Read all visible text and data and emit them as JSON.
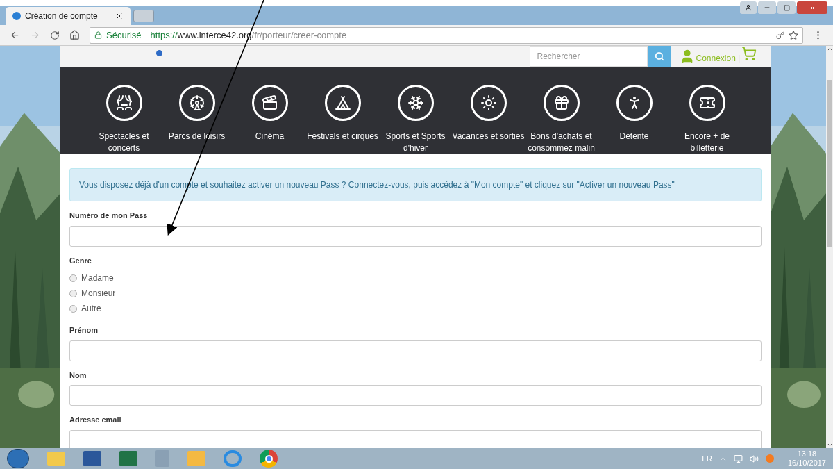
{
  "browser": {
    "tabs": [
      {
        "title": "Création de compte",
        "selected": true
      }
    ],
    "secure_label": "Sécurisé",
    "url_scheme": "https://",
    "url_host": "www.interce42.org",
    "url_path": "/fr/porteur/creer-compte"
  },
  "header": {
    "search": {
      "placeholder": "Rechercher"
    },
    "login": "Connexion",
    "separator": "|"
  },
  "nav": [
    {
      "label": "Spectacles et concerts"
    },
    {
      "label": "Parcs de loisirs"
    },
    {
      "label": "Cinéma"
    },
    {
      "label": "Festivals et cirques"
    },
    {
      "label": "Sports et Sports d'hiver"
    },
    {
      "label": "Vacances et sorties"
    },
    {
      "label": "Bons d'achats et consommez malin"
    },
    {
      "label": "Détente"
    },
    {
      "label": "Encore + de billetterie"
    }
  ],
  "alert": "Vous disposez déjà d'un compte et souhaitez activer un nouveau Pass ? Connectez-vous, puis accédez à \"Mon compte\" et cliquez sur \"Activer un nouveau Pass\"",
  "form": [
    {
      "kind": "text",
      "label": "Numéro de mon Pass"
    },
    {
      "kind": "radio",
      "label": "Genre",
      "options": [
        {
          "label": "Madame",
          "selected": false
        },
        {
          "label": "Monsieur",
          "selected": false
        },
        {
          "label": "Autre",
          "selected": false
        }
      ]
    },
    {
      "kind": "text",
      "label": "Prénom"
    },
    {
      "kind": "text",
      "label": "Nom"
    },
    {
      "kind": "text",
      "label": "Adresse email"
    }
  ],
  "taskbar": {
    "language": "FR",
    "time": "13:18",
    "date": "16/10/2017"
  }
}
